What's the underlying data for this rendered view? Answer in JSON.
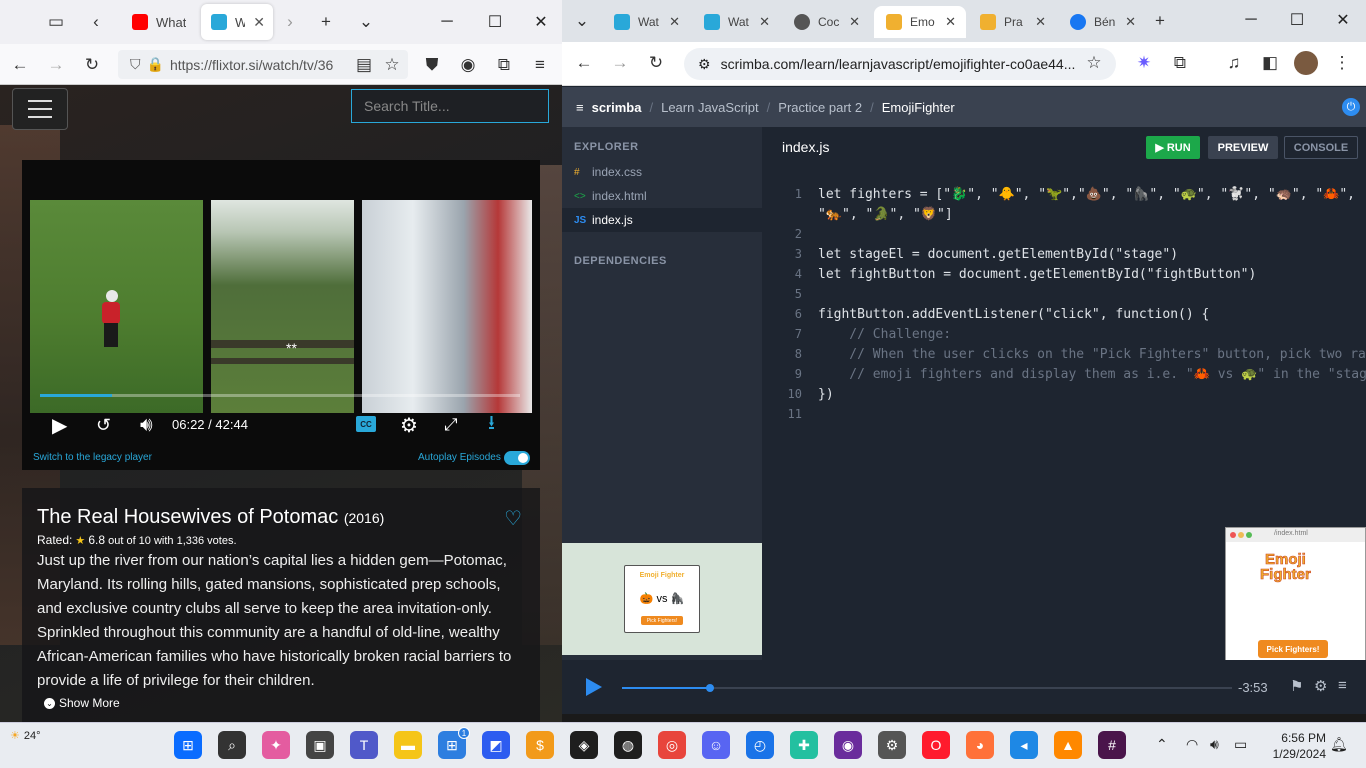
{
  "left_window": {
    "tabs": [
      {
        "title": "What",
        "color": "#ff0000"
      },
      {
        "title": "Wat",
        "color": "#29a8d9"
      }
    ],
    "url": "https://flixtor.si/watch/tv/36",
    "page": {
      "search_placeholder": "Search Title...",
      "player": {
        "current_time": "06:22",
        "separator": "/",
        "duration": "42:44",
        "progress_fraction": 0.149,
        "subtitle_mark": "**",
        "cc_label": "CC",
        "legacy_link": "Switch to the legacy player",
        "autoplay_label": "Autoplay Episodes"
      },
      "show": {
        "title": "The Real Housewives of Potomac",
        "year": "(2016)",
        "rated_label": "Rated:",
        "rating": "6.8",
        "rating_suffix": "out of 10 with 1,336 votes.",
        "description": "Just up the river from our nation’s capital lies a hidden gem—Potomac, Maryland. Its rolling hills, gated mansions, sophisticated prep schools, and exclusive country clubs all serve to keep the area invitation-only. Sprinkled throughout this community are a handful of old-line, wealthy African-American families who have historically broken racial barriers to provide a life of privilege for their children.",
        "show_more": "Show More"
      }
    }
  },
  "right_window": {
    "tabs": [
      {
        "title": "Wat",
        "color": "#29a8d9"
      },
      {
        "title": "Wat",
        "color": "#29a8d9"
      },
      {
        "title": "Coc",
        "color": "#555555"
      },
      {
        "title": "Emo",
        "color": "#f0b030"
      },
      {
        "title": "Pra",
        "color": "#f0b030"
      },
      {
        "title": "Bén",
        "color": "#1877f2"
      }
    ],
    "url": "scrimba.com/learn/learnjavascript/emojifighter-co0ae44...",
    "scrimba": {
      "logo": "scrimba",
      "breadcrumbs": [
        "Learn JavaScript",
        "Practice part 2",
        "EmojiFighter"
      ],
      "explorer_label": "EXPLORER",
      "dependencies_label": "DEPENDENCIES",
      "files": [
        {
          "icon": "#",
          "name": "index.css",
          "color": "#f0b030"
        },
        {
          "icon": "<>",
          "name": "index.html",
          "color": "#1ca84a"
        },
        {
          "icon": "JS",
          "name": "index.js",
          "color": "#2d8cf0"
        }
      ],
      "active_file": "index.js",
      "run_label": "RUN",
      "preview_label": "PREVIEW",
      "console_label": "CONSOLE",
      "code_lines": [
        {
          "n": "1",
          "text": "let fighters = [\"🐉\", \"🐥\", \"🦖\",\"💩\", \"🦍\", \"🐢\", \"🐩\", \"🦔\", \"🦀\","
        },
        {
          "n": "",
          "text": "\"🐅\", \"🐊\", \"🦁\"]"
        },
        {
          "n": "2",
          "text": ""
        },
        {
          "n": "3",
          "text": "let stageEl = document.getElementById(\"stage\")"
        },
        {
          "n": "4",
          "text": "let fightButton = document.getElementById(\"fightButton\")"
        },
        {
          "n": "5",
          "text": ""
        },
        {
          "n": "6",
          "text": "fightButton.addEventListener(\"click\", function() {"
        },
        {
          "n": "7",
          "text": "    // Challenge:"
        },
        {
          "n": "8",
          "text": "    // When the user clicks on the \"Pick Fighters\" button, pick two ra"
        },
        {
          "n": "9",
          "text": "    // emoji fighters and display them as i.e. \"🦀 vs 🐢\" in the \"stag"
        },
        {
          "n": "10",
          "text": "})"
        },
        {
          "n": "11",
          "text": ""
        }
      ],
      "video_time": "-3:53",
      "video_progress_fraction": 0.145,
      "preview_title_line1": "Emoji",
      "preview_title_line2": "Fighter",
      "preview_button": "Pick Fighters!",
      "preview_url": "/index.html",
      "mini_title": "Emoji Fighter",
      "mini_vs": "🎃 vs 🦍",
      "mini_button": "Pick Fighters!"
    }
  },
  "taskbar": {
    "weather": "24°",
    "time": "6:56 PM",
    "date": "1/29/2024",
    "apps": [
      {
        "name": "start",
        "color": "#0a6cff"
      },
      {
        "name": "search",
        "color": "#333333"
      },
      {
        "name": "copilot",
        "color": "#e45ca0"
      },
      {
        "name": "task-view",
        "color": "#444444"
      },
      {
        "name": "teams",
        "color": "#5059c9"
      },
      {
        "name": "explorer",
        "color": "#f5c518"
      },
      {
        "name": "store",
        "color": "#2d7ee0"
      },
      {
        "name": "app1",
        "color": "#2d5cf0"
      },
      {
        "name": "app2",
        "color": "#f29a1a"
      },
      {
        "name": "figma",
        "color": "#1e1e1e"
      },
      {
        "name": "github",
        "color": "#1e1e1e"
      },
      {
        "name": "chrome",
        "color": "#e8453c"
      },
      {
        "name": "discord",
        "color": "#5865f2"
      },
      {
        "name": "app3",
        "color": "#1a73e8"
      },
      {
        "name": "app4",
        "color": "#23c0a0"
      },
      {
        "name": "app5",
        "color": "#6a2c9c"
      },
      {
        "name": "settings",
        "color": "#555555"
      },
      {
        "name": "opera",
        "color": "#ff1b2d"
      },
      {
        "name": "firefox",
        "color": "#ff7139"
      },
      {
        "name": "vscode",
        "color": "#1e88e5"
      },
      {
        "name": "vlc",
        "color": "#ff8800"
      },
      {
        "name": "slack",
        "color": "#4a154b"
      }
    ],
    "store_badge": "1"
  }
}
